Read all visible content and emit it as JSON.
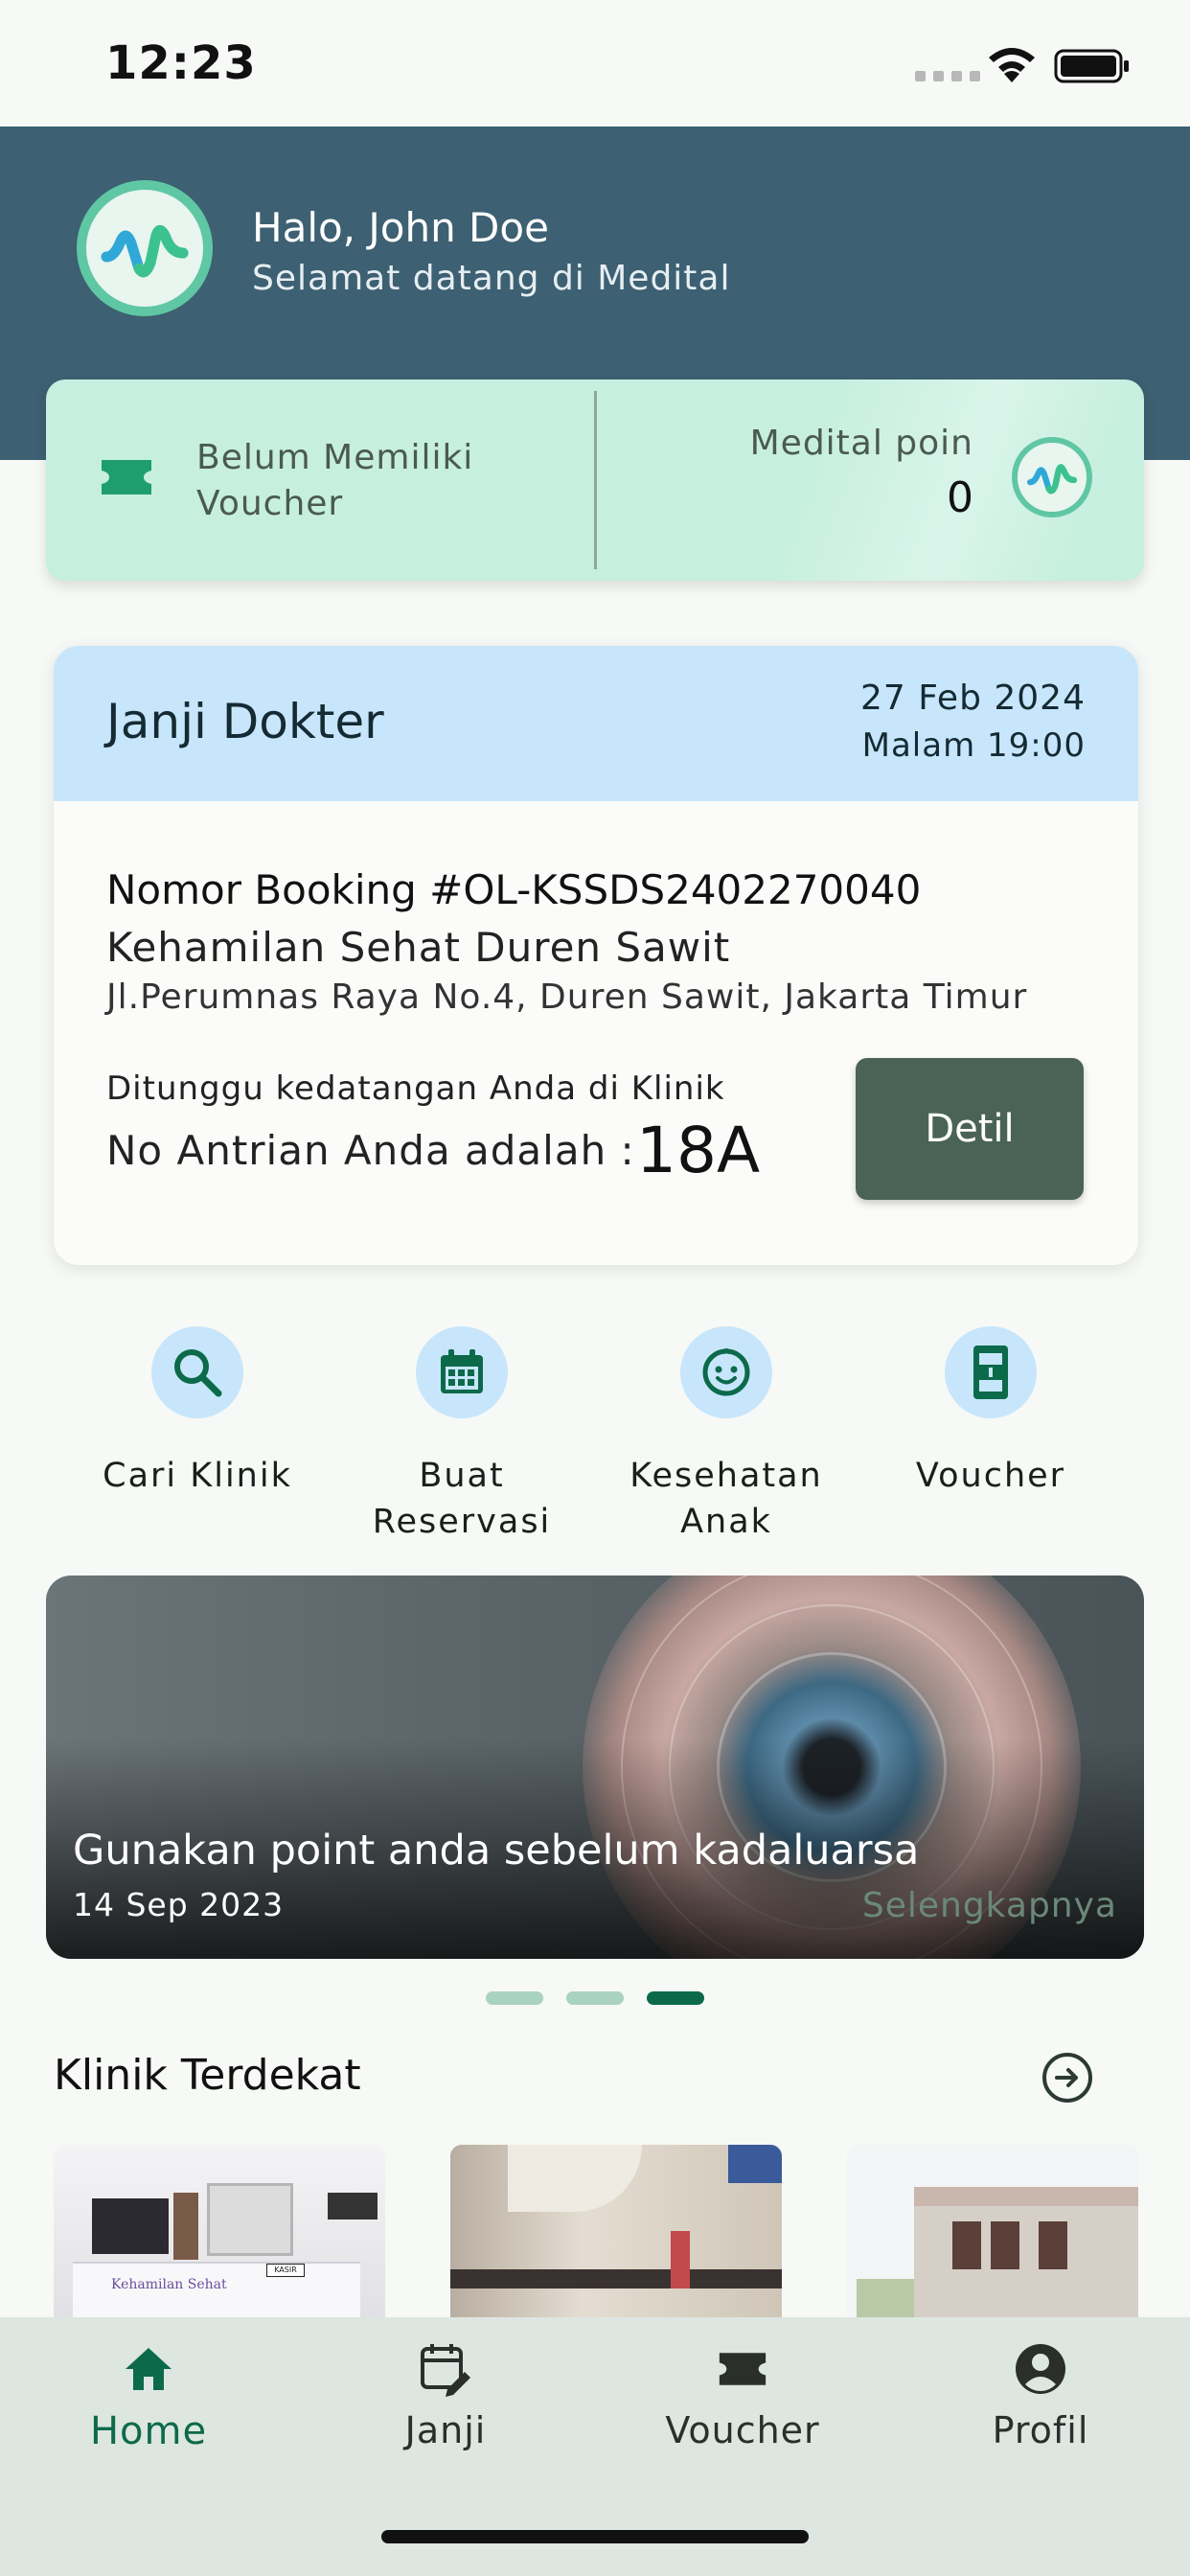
{
  "status_bar": {
    "time": "12:23"
  },
  "header": {
    "greeting": "Halo, John Doe",
    "subtitle": "Selamat datang di Medital"
  },
  "points_card": {
    "voucher_line1": "Belum Memiliki",
    "voucher_line2": "Voucher",
    "points_label": "Medital poin",
    "points_value": "0"
  },
  "appointment": {
    "title": "Janji Dokter",
    "date": "27 Feb 2024",
    "time": "Malam 19:00",
    "booking_number": "Nomor Booking #OL-KSSDS2402270040",
    "clinic_name": "Kehamilan Sehat Duren Sawit",
    "clinic_address": "Jl.Perumnas Raya No.4, Duren Sawit, Jakarta Timur",
    "await_text": "Ditunggu kedatangan Anda di Klinik",
    "queue_label": "No Antrian Anda adalah :",
    "queue_number": "18A",
    "detail_button": "Detil"
  },
  "quick_menu": [
    {
      "line1": "Cari Klinik",
      "line2": "",
      "icon": "search-icon"
    },
    {
      "line1": "Buat",
      "line2": "Reservasi",
      "icon": "calendar-icon"
    },
    {
      "line1": "Kesehatan",
      "line2": "Anak",
      "icon": "baby-face-icon"
    },
    {
      "line1": "Voucher",
      "line2": "",
      "icon": "voucher-icon"
    }
  ],
  "banner": {
    "title": "Gunakan point anda sebelum kadaluarsa",
    "date": "14 Sep 2023",
    "more_link": "Selengkapnya",
    "active_page": 3,
    "page_count": 3
  },
  "nearby": {
    "title": "Klinik Terdekat",
    "thumb_caption": "Kehamilan Sehat",
    "thumb_sign": "KASIR"
  },
  "bottom_nav": [
    {
      "label": "Home",
      "icon": "home-icon",
      "active": true
    },
    {
      "label": "Janji",
      "icon": "calendar-edit-icon",
      "active": false
    },
    {
      "label": "Voucher",
      "icon": "ticket-icon",
      "active": false
    },
    {
      "label": "Profil",
      "icon": "profile-icon",
      "active": false
    }
  ],
  "colors": {
    "header": "#3d6072",
    "brand_green": "#0c6a4a",
    "points_card": "#c6efdf",
    "appointment_header": "#c7e6fb",
    "detail_button": "#4a6356",
    "nav_background": "#dde6e0"
  }
}
